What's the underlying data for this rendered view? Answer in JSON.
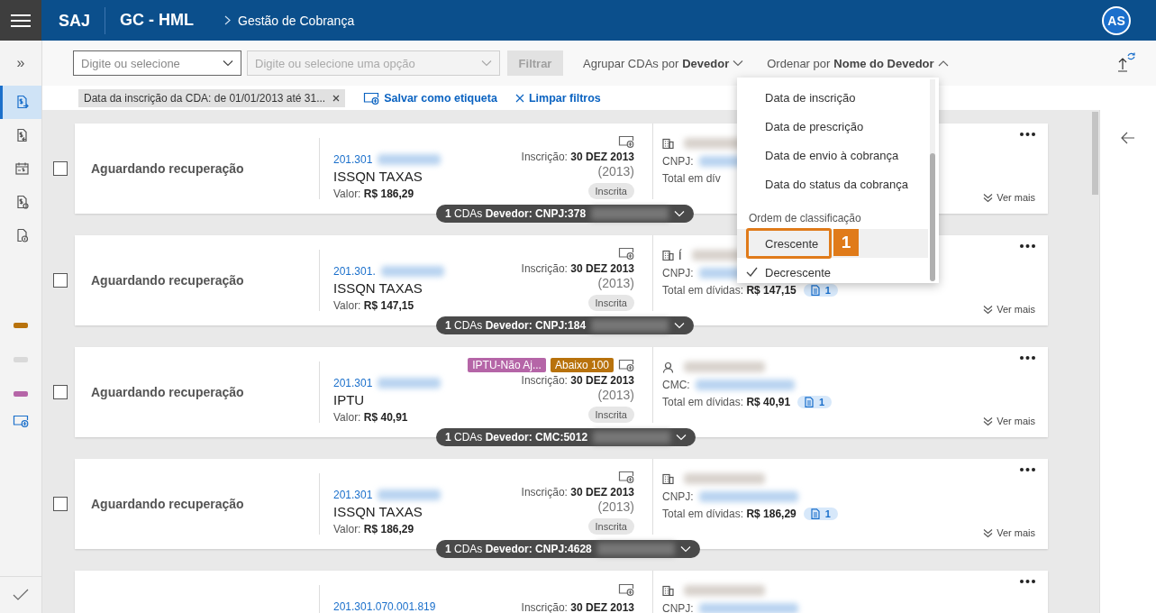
{
  "header": {
    "app": "SAJ",
    "module": "GC - HML",
    "breadcrumb": "Gestão de Cobrança",
    "avatar": "AS"
  },
  "sidebar": {
    "expand": "»",
    "nav_items": [
      {
        "selected": true
      },
      {
        "selected": false
      },
      {
        "selected": false
      },
      {
        "selected": false
      },
      {
        "selected": false
      }
    ],
    "tag_colors": [
      {
        "color": "#b8720c"
      },
      {
        "color": "#d9d9d9"
      },
      {
        "color": "#b565a7"
      }
    ]
  },
  "toolbar": {
    "field_1": {
      "placeholder": "Digite ou selecione",
      "disabled": false
    },
    "field_2": {
      "placeholder": "Digite ou selecione uma opção",
      "disabled": true
    },
    "filter_button": {
      "label": "Filtrar",
      "disabled": true
    },
    "group_by": {
      "label": "Agrupar CDAs por",
      "value": "Devedor",
      "expanded": false
    },
    "sort_by": {
      "label": "Ordenar por",
      "value": "Nome do Devedor",
      "expanded": true
    }
  },
  "filters": {
    "chips": [
      {
        "label": "Data da inscrição da CDA: de 01/01/2013 até 31..."
      }
    ],
    "save_label": "Salvar como etiqueta",
    "clear_label": "Limpar filtros"
  },
  "sort_menu": {
    "items": [
      {
        "label": "Data de inscrição",
        "selected": false
      },
      {
        "label": "Data de prescrição",
        "selected": false
      },
      {
        "label": "Data de envio à cobrança",
        "selected": false
      },
      {
        "label": "Data do status da cobrança",
        "selected": false
      }
    ],
    "order_heading": "Ordem de classificação",
    "order_options": [
      {
        "label": "Crescente",
        "checked": false,
        "hovered": true
      },
      {
        "label": "Decrescente",
        "checked": true,
        "hovered": false
      }
    ],
    "annotation": {
      "number": "1"
    }
  },
  "cards": [
    {
      "status": "Aguardando recuperação",
      "checked": false,
      "cda_number": "201.301",
      "type": "ISSQN TAXAS",
      "valor_label": "Valor:",
      "valor": "R$ 186,29",
      "inscricao_label": "Inscrição:",
      "inscricao_date": "30 DEZ 2013",
      "year": "(2013)",
      "situation": "Inscrita",
      "kind": "company",
      "id_label": "CNPJ:",
      "total_label": "Total em dív",
      "more": "Ver mais",
      "group_pill": "**1** CDAs **Devedor: CNPJ:378**"
    },
    {
      "status": "Aguardando recuperação",
      "checked": false,
      "cda_number": "201.301.",
      "type": "ISSQN TAXAS",
      "valor_label": "Valor:",
      "valor": "R$ 147,15",
      "inscricao_label": "Inscrição:",
      "inscricao_date": "30 DEZ 2013",
      "year": "(2013)",
      "situation": "Inscrita",
      "kind": "company",
      "name": "Í",
      "id_label": "CNPJ:",
      "total_label": "Total em dívidas:",
      "total_value": "R$ 147,15",
      "doc_count": "1",
      "more": "Ver mais",
      "group_pill": "**1** CDAs **Devedor: CNPJ:184**"
    },
    {
      "status": "Aguardando recuperação",
      "checked": false,
      "cda_number": "201.301",
      "type": "IPTU",
      "valor_label": "Valor:",
      "valor": "R$ 40,91",
      "tags": [
        {
          "label": "IPTU-Não Aj...",
          "color": "#b565a7"
        },
        {
          "label": "Abaixo 100",
          "color": "#b8720c"
        }
      ],
      "inscricao_label": "Inscrição:",
      "inscricao_date": "30 DEZ 2013",
      "year": "(2013)",
      "situation": "Inscrita",
      "kind": "person",
      "id_label": "CMC:",
      "total_label": "Total em dívidas:",
      "total_value": "R$ 40,91",
      "doc_count": "1",
      "more": "Ver mais",
      "group_pill": "**1** CDAs **Devedor: CMC:5012**"
    },
    {
      "status": "Aguardando recuperação",
      "checked": false,
      "cda_number": "201.301",
      "type": "ISSQN TAXAS",
      "valor_label": "Valor:",
      "valor": "R$ 186,29",
      "inscricao_label": "Inscrição:",
      "inscricao_date": "30 DEZ 2013",
      "year": "(2013)",
      "situation": "Inscrita",
      "kind": "company",
      "id_label": "CNPJ:",
      "total_label": "Total em dívidas:",
      "total_value": "R$ 186,29",
      "doc_count": "1",
      "more": "Ver mais",
      "group_pill": "**1** CDAs **Devedor: CNPJ:4628**"
    },
    {
      "cda_number": "201.301.070.001.819",
      "inscricao_label": "Inscrição:",
      "inscricao_date": "30 DEZ 2013",
      "kind": "company",
      "id_label": "CNPJ:"
    }
  ]
}
